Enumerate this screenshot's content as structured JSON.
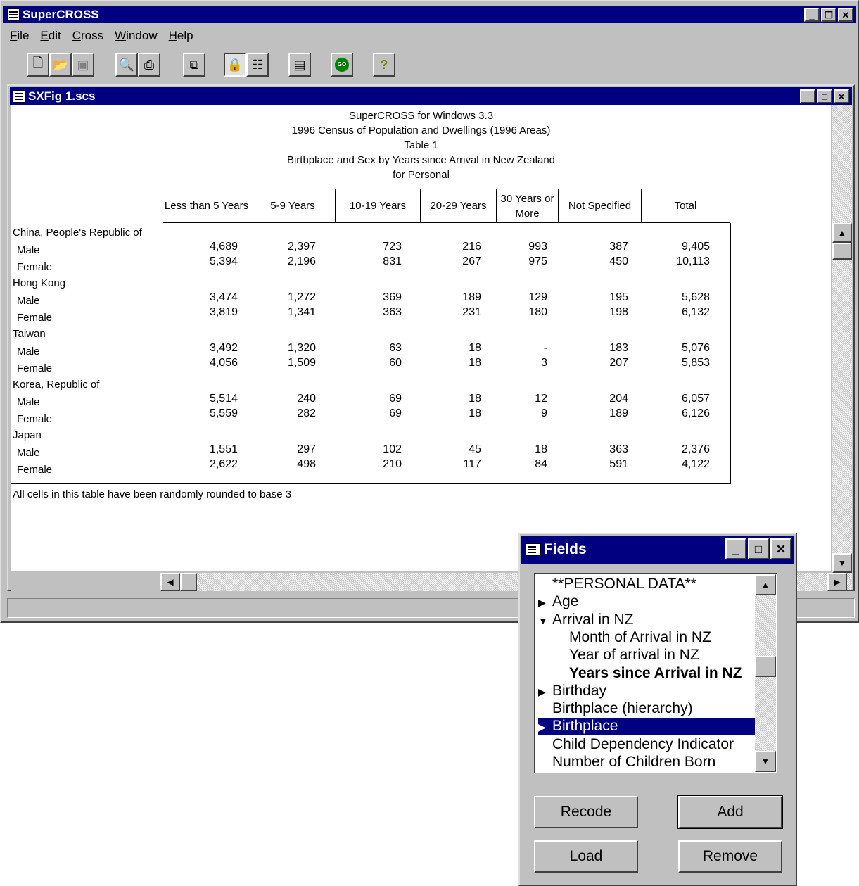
{
  "app": {
    "title": "SuperCROSS"
  },
  "menu": [
    "File",
    "Edit",
    "Cross",
    "Window",
    "Help"
  ],
  "toolbar_icons": [
    "new-icon",
    "open-icon",
    "save-icon",
    "print-preview-icon",
    "print-icon",
    "copy-icon",
    "lock-icon",
    "layout-icon",
    "add-field-icon",
    "go-icon",
    "help-icon"
  ],
  "doc": {
    "title": "SXFig 1.scs"
  },
  "table": {
    "header_lines": [
      "SuperCROSS for Windows 3.3",
      "1996 Census of Population and Dwellings (1996 Areas)",
      "Table 1",
      "Birthplace and Sex by Years since Arrival in New Zealand",
      "for Personal"
    ],
    "columns": [
      "Less than 5 Years",
      "5-9 Years",
      "10-19 Years",
      "20-29 Years",
      "30 Years or More",
      "Not Specified",
      "Total"
    ],
    "groups": [
      {
        "name": "China, People's Republic of",
        "rows": [
          {
            "label": "Male",
            "values": [
              "4,689",
              "2,397",
              "723",
              "216",
              "993",
              "387",
              "9,405"
            ]
          },
          {
            "label": "Female",
            "values": [
              "5,394",
              "2,196",
              "831",
              "267",
              "975",
              "450",
              "10,113"
            ]
          }
        ]
      },
      {
        "name": "Hong Kong",
        "rows": [
          {
            "label": "Male",
            "values": [
              "3,474",
              "1,272",
              "369",
              "189",
              "129",
              "195",
              "5,628"
            ]
          },
          {
            "label": "Female",
            "values": [
              "3,819",
              "1,341",
              "363",
              "231",
              "180",
              "198",
              "6,132"
            ]
          }
        ]
      },
      {
        "name": "Taiwan",
        "rows": [
          {
            "label": "Male",
            "values": [
              "3,492",
              "1,320",
              "63",
              "18",
              "-",
              "183",
              "5,076"
            ]
          },
          {
            "label": "Female",
            "values": [
              "4,056",
              "1,509",
              "60",
              "18",
              "3",
              "207",
              "5,853"
            ]
          }
        ]
      },
      {
        "name": "Korea, Republic of",
        "rows": [
          {
            "label": "Male",
            "values": [
              "5,514",
              "240",
              "69",
              "18",
              "12",
              "204",
              "6,057"
            ]
          },
          {
            "label": "Female",
            "values": [
              "5,559",
              "282",
              "69",
              "18",
              "9",
              "189",
              "6,126"
            ]
          }
        ]
      },
      {
        "name": "Japan",
        "rows": [
          {
            "label": "Male",
            "values": [
              "1,551",
              "297",
              "102",
              "45",
              "18",
              "363",
              "2,376"
            ]
          },
          {
            "label": "Female",
            "values": [
              "2,622",
              "498",
              "210",
              "117",
              "84",
              "591",
              "4,122"
            ]
          }
        ]
      }
    ],
    "footnote": "All cells in this table have been randomly rounded to base 3"
  },
  "fields": {
    "title": "Fields",
    "items": [
      {
        "label": "**PERSONAL DATA**",
        "level": 1,
        "arrow": "",
        "bold": false,
        "selected": false
      },
      {
        "label": "Age",
        "level": 1,
        "arrow": "right",
        "bold": false,
        "selected": false
      },
      {
        "label": "Arrival in NZ",
        "level": 1,
        "arrow": "down",
        "bold": false,
        "selected": false
      },
      {
        "label": "Month of Arrival in NZ",
        "level": 2,
        "arrow": "",
        "bold": false,
        "selected": false
      },
      {
        "label": "Year of arrival in NZ",
        "level": 2,
        "arrow": "",
        "bold": false,
        "selected": false
      },
      {
        "label": "Years since Arrival in NZ",
        "level": 2,
        "arrow": "",
        "bold": true,
        "selected": false
      },
      {
        "label": "Birthday",
        "level": 1,
        "arrow": "right",
        "bold": false,
        "selected": false
      },
      {
        "label": "Birthplace (hierarchy)",
        "level": 1,
        "arrow": "",
        "bold": false,
        "selected": false
      },
      {
        "label": "Birthplace",
        "level": 1,
        "arrow": "right",
        "bold": false,
        "selected": true
      },
      {
        "label": "Child Dependency Indicator",
        "level": 1,
        "arrow": "",
        "bold": false,
        "selected": false
      },
      {
        "label": "Number of Children Born",
        "level": 1,
        "arrow": "",
        "bold": false,
        "selected": false
      }
    ],
    "buttons": {
      "recode": "Recode",
      "add": "Add",
      "load": "Load",
      "remove": "Remove"
    }
  }
}
